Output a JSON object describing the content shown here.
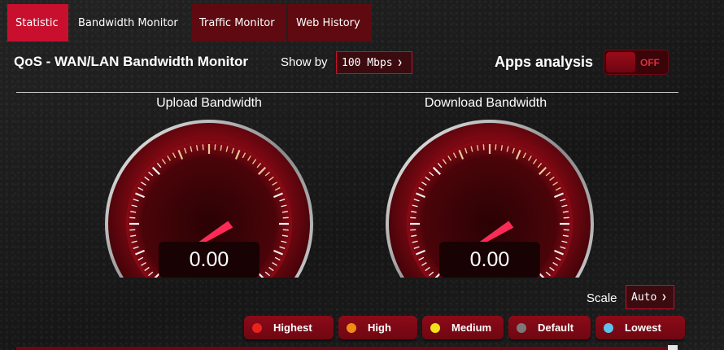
{
  "tabs": [
    {
      "label": "Statistic",
      "active": true
    },
    {
      "label": "Bandwidth Monitor",
      "active": false
    },
    {
      "label": "Traffic Monitor",
      "active": false
    },
    {
      "label": "Web History",
      "active": false
    }
  ],
  "header": {
    "title": "QoS - WAN/LAN Bandwidth Monitor",
    "show_by_label": "Show by",
    "show_by_value": "100 Mbps",
    "apps_analysis_label": "Apps analysis",
    "apps_analysis_state": "OFF"
  },
  "gauges": {
    "upload": {
      "title": "Upload Bandwidth",
      "value": "0.00"
    },
    "download": {
      "title": "Download Bandwidth",
      "value": "0.00"
    }
  },
  "scale": {
    "label": "Scale",
    "value": "Auto"
  },
  "legend": [
    {
      "label": "Highest",
      "color": "#e8231c"
    },
    {
      "label": "High",
      "color": "#f08c14"
    },
    {
      "label": "Medium",
      "color": "#f2e21b"
    },
    {
      "label": "Default",
      "color": "#7a7a7a"
    },
    {
      "label": "Lowest",
      "color": "#5ec3ea"
    }
  ],
  "colors": {
    "accent": "#c8102e",
    "dark_red": "#5e0a10"
  }
}
